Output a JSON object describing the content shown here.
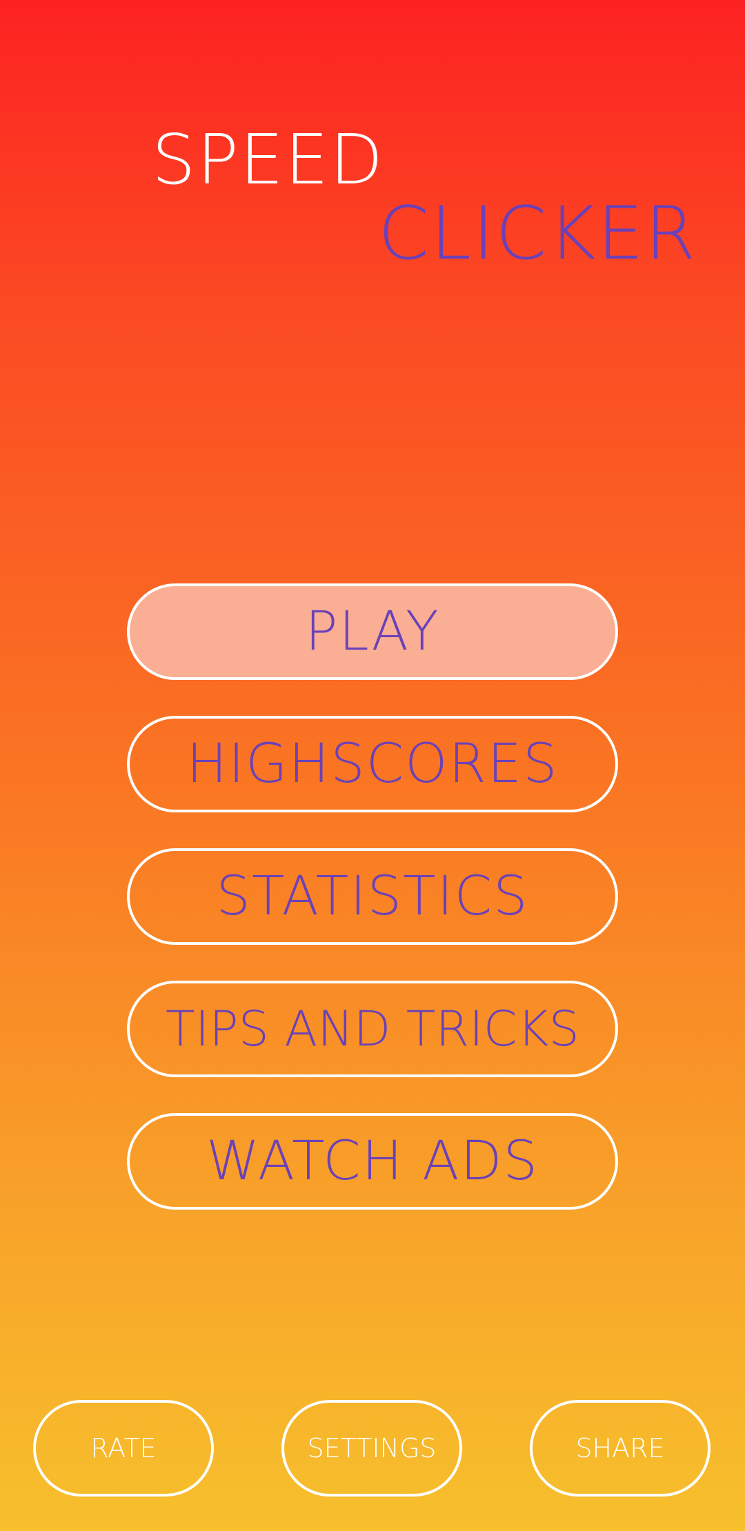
{
  "app": {
    "title_line1": "SPEED",
    "title_line2": "CLICKER"
  },
  "menu": {
    "play": "PLAY",
    "highscores": "HIGHSCORES",
    "statistics": "STATISTICS",
    "tips": "TIPS AND TRICKS",
    "watch_ads": "WATCH ADS"
  },
  "bottom": {
    "rate": "RATE",
    "settings": "SETTINGS",
    "share": "SHARE"
  },
  "colors": {
    "background_top": "#fd2222",
    "background_bottom": "#f7c02c",
    "accent_purple": "#6a41b8",
    "primary_button_fill": "#faae94",
    "outline": "#ffffff"
  }
}
